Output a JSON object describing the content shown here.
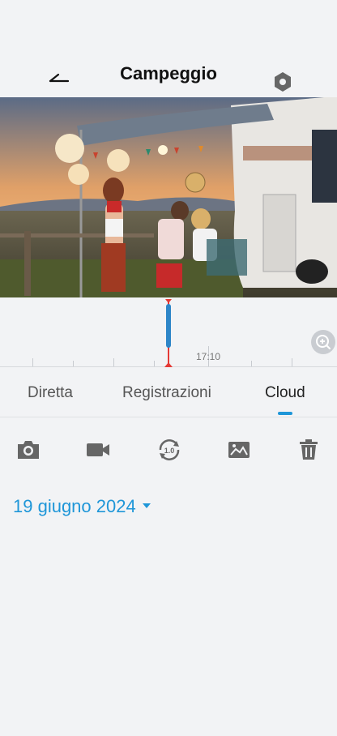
{
  "header": {
    "title": "Campeggio",
    "back_icon": "back-arrow-icon",
    "settings_icon": "hexagon-settings-icon"
  },
  "timeline": {
    "time_label": "17:10",
    "zoom_icon": "zoom-in-icon"
  },
  "tabs": [
    {
      "label": "Diretta"
    },
    {
      "label": "Registrazioni"
    },
    {
      "label": "Cloud",
      "active": true
    }
  ],
  "toolbar": {
    "icons": [
      "camera-icon",
      "video-camera-icon",
      "playback-speed-icon",
      "image-icon",
      "trash-icon"
    ],
    "speed_badge": "1.0"
  },
  "date": {
    "label": "19 giugno 2024"
  },
  "colors": {
    "accent": "#1e96d8",
    "cursor": "#e53935",
    "clip": "#2e86c8",
    "background": "#f2f3f5"
  }
}
